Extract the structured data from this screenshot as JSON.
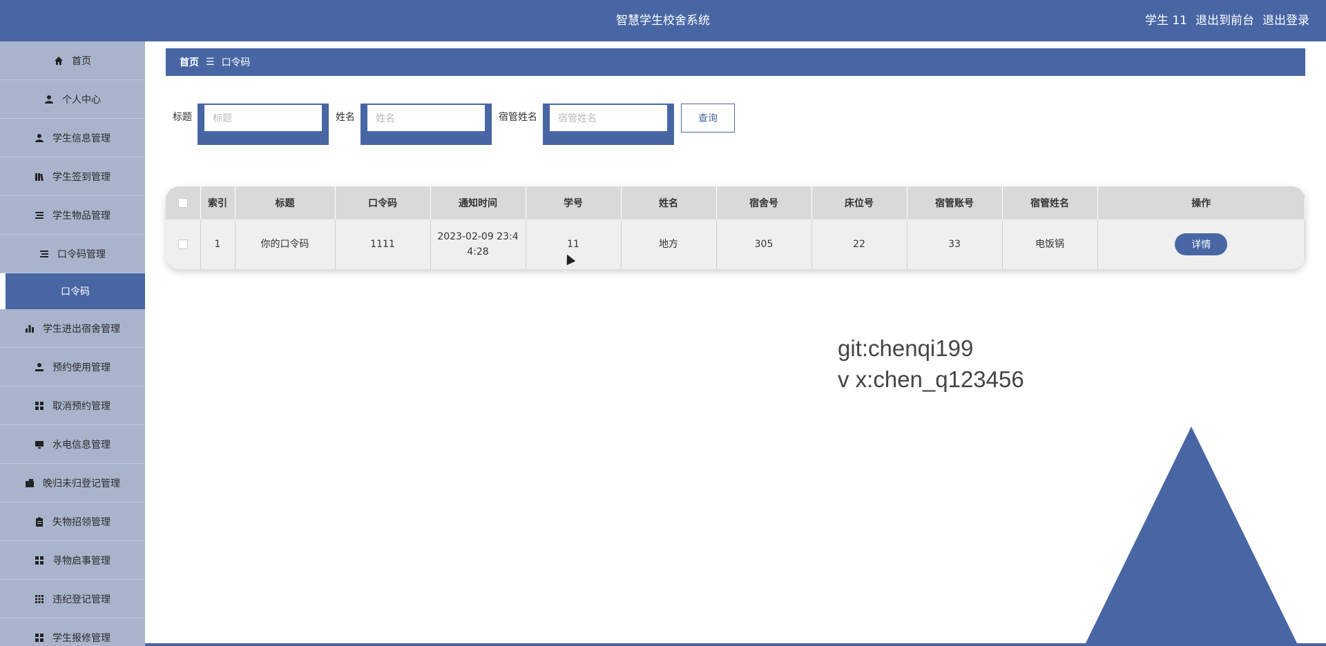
{
  "header": {
    "title": "智慧学生校舍系统",
    "user": "学生 11",
    "to_front": "退出到前台",
    "logout": "退出登录"
  },
  "sidebar": {
    "items": [
      {
        "label": "首页",
        "icon": "home-icon"
      },
      {
        "label": "个人中心",
        "icon": "user-icon"
      },
      {
        "label": "学生信息管理",
        "icon": "user-icon"
      },
      {
        "label": "学生签到管理",
        "icon": "book-icon"
      },
      {
        "label": "学生物品管理",
        "icon": "list-icon"
      },
      {
        "label": "口令码管理",
        "icon": "list-icon"
      },
      {
        "label": "口令码",
        "icon": ""
      },
      {
        "label": "学生进出宿舍管理",
        "icon": "bar-chart-icon"
      },
      {
        "label": "预约使用管理",
        "icon": "user-icon"
      },
      {
        "label": "取消预约管理",
        "icon": "grid-icon"
      },
      {
        "label": "水电信息管理",
        "icon": "monitor-icon"
      },
      {
        "label": "晚归未归登记管理",
        "icon": "wallet-icon"
      },
      {
        "label": "失物招领管理",
        "icon": "clipboard-icon"
      },
      {
        "label": "寻物启事管理",
        "icon": "grid-icon"
      },
      {
        "label": "违纪登记管理",
        "icon": "grid9-icon"
      },
      {
        "label": "学生报修管理",
        "icon": "grid-icon"
      }
    ]
  },
  "breadcrumb": {
    "home": "首页",
    "sep": "☰",
    "current": "口令码"
  },
  "search": {
    "title_label": "标题",
    "title_placeholder": "标题",
    "name_label": "姓名",
    "name_placeholder": "姓名",
    "manager_label": "宿管姓名",
    "manager_placeholder": "宿管姓名",
    "query_button": "查询"
  },
  "table": {
    "headers": [
      "索引",
      "标题",
      "口令码",
      "通知时间",
      "学号",
      "姓名",
      "宿舍号",
      "床位号",
      "宿管账号",
      "宿管姓名",
      "操作"
    ],
    "rows": [
      {
        "index": "1",
        "title": "你的口令码",
        "code": "1111",
        "time_line1": "2023-02-09 23:4",
        "time_line2": "4:28",
        "student_no": "11",
        "name": "地方",
        "dorm_no": "305",
        "bed_no": "22",
        "manager_account": "33",
        "manager_name": "电饭锅",
        "action": "详情"
      }
    ]
  },
  "watermark": {
    "line1": "git:chenqi199",
    "line2": "v x:chen_q123456"
  },
  "colors": {
    "primary": "#4766a3",
    "sidebar": "#a9b4cc"
  }
}
